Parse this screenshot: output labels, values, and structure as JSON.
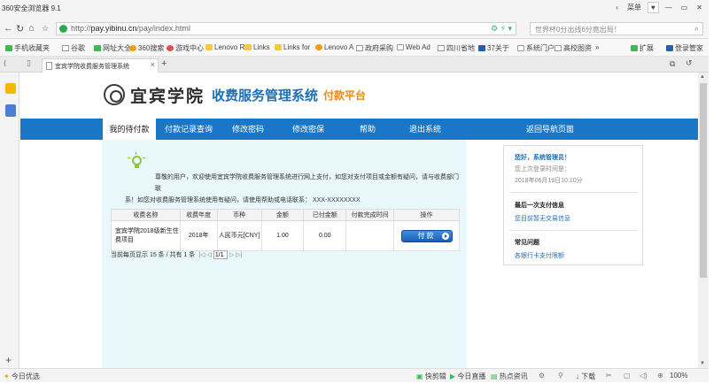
{
  "browser": {
    "app_title": "360安全浏览器 9.1",
    "menu_label": "菜单",
    "url_prefix": "http://",
    "url_host": "pay.yibinu.cn",
    "url_path": "/pay/index.html",
    "search_placeholder": "世界杯0分出线6分竟出局！",
    "bookmarks": [
      "手机收藏夹",
      "谷歌",
      "网址大全",
      "360搜索",
      "游戏中心",
      "Lenovo R",
      "Links",
      "Links for",
      "Lenovo A",
      "政府采购",
      "Web Ad",
      "四川省地",
      "37关于",
      "系统门户",
      "高校图资"
    ],
    "bookmark_more": "»",
    "ext_label": "扩展",
    "login_label": "登录管家",
    "tab_title": "宜宾学院收费服务管理系统",
    "status_left": "今日优选",
    "status_items": [
      "快剪辑",
      "今日直播",
      "热点资讯"
    ],
    "download_label": "下载",
    "zoom": "100%"
  },
  "header": {
    "school_name": "宜宾学院",
    "system_name": "收费服务管理系统",
    "platform": "付款平台"
  },
  "nav": {
    "items": [
      "我的待付款",
      "付款记录查询",
      "修改密码",
      "修改密保",
      "帮助",
      "退出系统",
      "返回导航页面"
    ]
  },
  "notice": {
    "line1": "尊敬的用户，欢迎使用宜宾学院收费服务管理系统进行网上支付，如您对支付项目或金额有疑问，请与收费部门联",
    "line2": "系！如您对收费服务管理系统使用有疑问，请使用帮助或电话联系： XXX-XXXXXXXX"
  },
  "table": {
    "headers": [
      "收费名称",
      "收费年度",
      "币种",
      "金额",
      "已付金额",
      "付款完成时间",
      "操作"
    ],
    "rows": [
      {
        "name": "宜宾学院2018级新生住费项目",
        "year": "2018年",
        "currency": "人民币元[CNY]",
        "amount": "1.00",
        "paid": "0.00",
        "done_time": "",
        "action": "付款"
      }
    ]
  },
  "pager": {
    "summary": "当前每页显示 15 条 / 共有 1 条",
    "page_value": "1/1"
  },
  "sidebar": {
    "greeting": "您好，系统管理员！",
    "last_login_label": "您上次登录时间是：",
    "last_login_time": "2018年06月19日10:10分",
    "last_pay_title": "最后一次支付信息",
    "last_pay_text": "您目前暂无交易信息",
    "faq_title": "常见问题",
    "faq_link": "各银行卡支付限额"
  }
}
